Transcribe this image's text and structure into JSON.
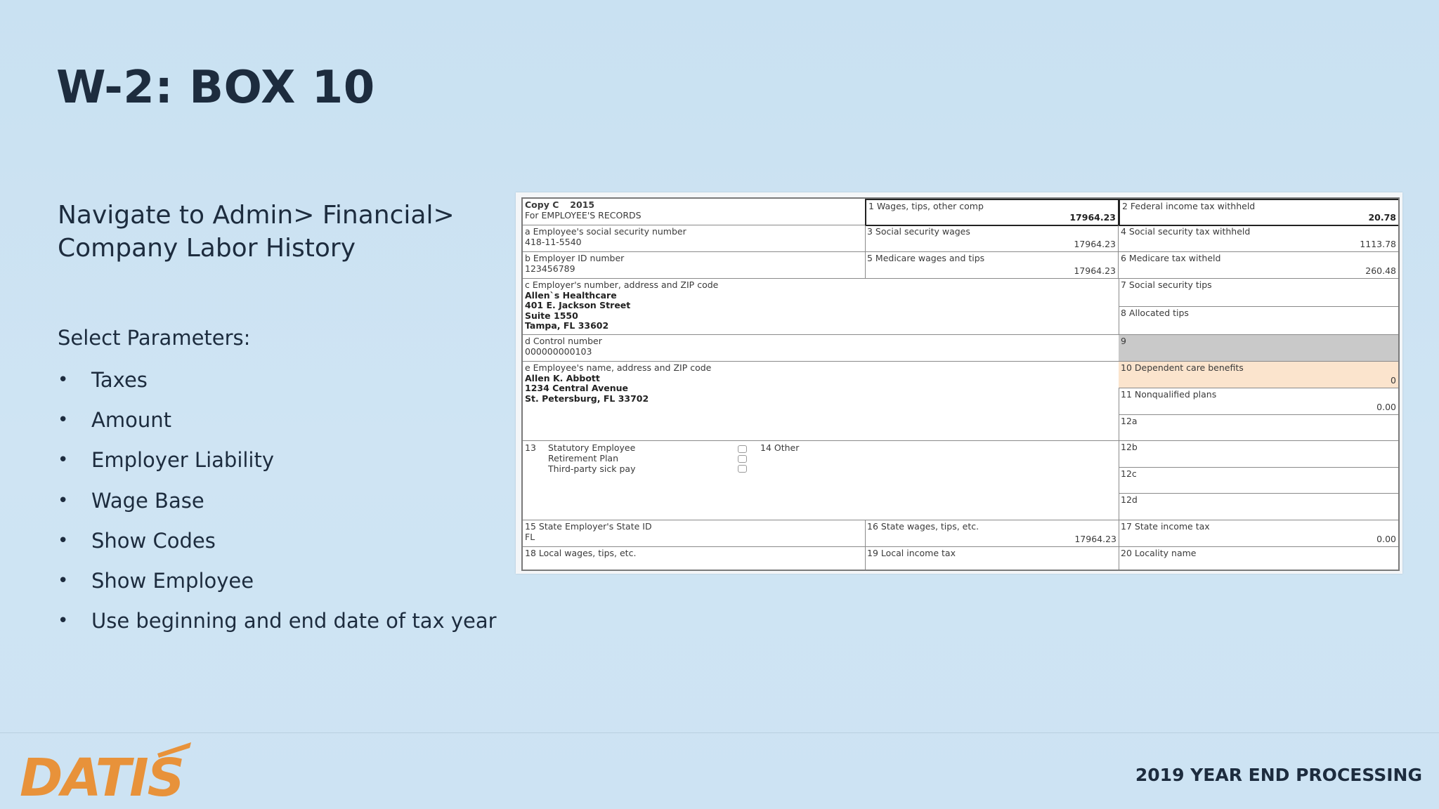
{
  "slide": {
    "title": "W-2: BOX 10",
    "nav_line1": "Navigate to Admin> Financial>",
    "nav_line2": "Company Labor History",
    "params_heading": "Select Parameters:",
    "params": [
      "Taxes",
      "Amount",
      "Employer Liability",
      "Wage Base",
      "Show Codes",
      "Show Employee",
      "Use beginning and end date of tax year"
    ],
    "footer": "2019 YEAR END PROCESSING",
    "logo_text": "DATIS",
    "accent_color": "#e8923a"
  },
  "w2": {
    "copy": "Copy C",
    "year": "2015",
    "copy_desc": "For EMPLOYEE'S RECORDS",
    "box1_label": "1 Wages, tips, other comp",
    "box1_value": "17964.23",
    "box2_label": "2 Federal income tax withheld",
    "box2_value": "20.78",
    "a_label": "a Employee's social security number",
    "a_value": "418-11-5540",
    "box3_label": "3 Social security wages",
    "box3_value": "17964.23",
    "box4_label": "4 Social security tax withheld",
    "box4_value": "1113.78",
    "b_label": "b Employer ID number",
    "b_value": "123456789",
    "box5_label": "5 Medicare wages and tips",
    "box5_value": "17964.23",
    "box6_label": "6 Medicare tax witheld",
    "box6_value": "260.48",
    "c_label": "c Employer's number, address and ZIP code",
    "c_lines": [
      "Allen`s Healthcare",
      "401 E. Jackson Street",
      "Suite 1550",
      "Tampa, FL 33602"
    ],
    "box7_label": "7 Social security tips",
    "box8_label": "8 Allocated tips",
    "d_label": "d Control number",
    "d_value": "000000000103",
    "box9_label": "9",
    "e_label": "e Employee's name, address and ZIP code",
    "e_lines": [
      "Allen K. Abbott",
      "1234 Central Avenue",
      "St. Petersburg, FL 33702"
    ],
    "box10_label": "10 Dependent care benefits",
    "box10_value": "0",
    "box11_label": "11 Nonqualified plans",
    "box11_value": "0.00",
    "box12a_label": "12a",
    "box12b_label": "12b",
    "box12c_label": "12c",
    "box12d_label": "12d",
    "box13_label": "13",
    "box13_items": [
      "Statutory Employee",
      "Retirement Plan",
      "Third-party sick pay"
    ],
    "box14_label": "14 Other",
    "box15_label": "15 State Employer's State ID",
    "box15_value": "FL",
    "box16_label": "16 State wages, tips, etc.",
    "box16_value": "17964.23",
    "box17_label": "17 State income tax",
    "box17_value": "0.00",
    "box18_label": "18 Local wages, tips, etc.",
    "box19_label": "19 Local income tax",
    "box20_label": "20 Locality name"
  }
}
